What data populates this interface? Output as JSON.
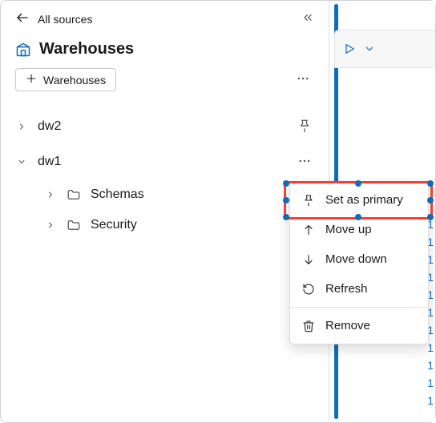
{
  "header": {
    "back_label": "All sources",
    "title": "Warehouses"
  },
  "toolbar": {
    "add_label": "Warehouses"
  },
  "tree": {
    "items": [
      {
        "label": "dw2",
        "expanded": false,
        "action_icon": "pin"
      },
      {
        "label": "dw1",
        "expanded": true,
        "action_icon": "more",
        "children": [
          {
            "label": "Schemas"
          },
          {
            "label": "Security"
          }
        ]
      }
    ]
  },
  "context_menu": {
    "items": [
      {
        "icon": "pin",
        "label": "Set as primary",
        "highlighted": true
      },
      {
        "icon": "arrow-up",
        "label": "Move up"
      },
      {
        "icon": "arrow-down",
        "label": "Move down"
      },
      {
        "icon": "refresh",
        "label": "Refresh"
      },
      {
        "separator": true
      },
      {
        "icon": "trash",
        "label": "Remove"
      }
    ]
  },
  "editor": {
    "line_numbers": [
      "1",
      "1",
      "1",
      "1",
      "1",
      "1",
      "1",
      "1",
      "1",
      "1",
      "1"
    ]
  }
}
